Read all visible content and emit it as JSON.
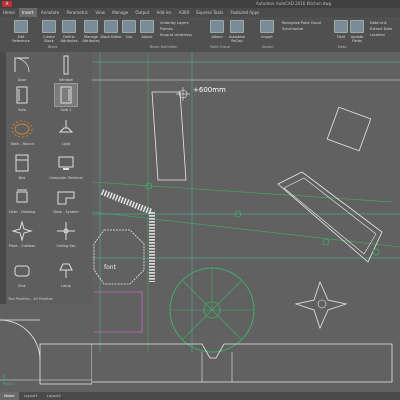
{
  "window": {
    "title": "Autodesk AutoCAD 2016   Kitchen.dwg",
    "app_badge": "A"
  },
  "menu": {
    "items": [
      "Home",
      "Insert",
      "Annotate",
      "Parametric",
      "View",
      "Manage",
      "Output",
      "Add-ins",
      "A360",
      "Express Tools",
      "Featured Apps"
    ],
    "active_index": 1
  },
  "ribbon": {
    "buttons": [
      "Edit Reference",
      "Create Block",
      "Define Attributes",
      "Manage Attributes",
      "Block Editor",
      "Clip",
      "Adjust",
      "Underlay Layers",
      "Frames",
      "Snap to Underlays",
      "Attach",
      "Autodesk ReCap",
      "Import",
      "Field",
      "Update Fields",
      "Data Link",
      "Extract Data"
    ],
    "small_items": [
      "Retain Attribute Display",
      "Synchronize",
      "Recognize Point Cloud",
      "Detach",
      "Location",
      "Set Location"
    ],
    "panels": [
      "Block",
      "Block Definition",
      "Reference",
      "Point Cloud",
      "Import",
      "Data",
      "Linking & Extraction",
      "Location"
    ]
  },
  "palette": {
    "tools": [
      {
        "label": "Door"
      },
      {
        "label": "Window"
      },
      {
        "label": "Sofa"
      },
      {
        "label": "Sofa 2"
      },
      {
        "label": "Table - Round"
      },
      {
        "label": "Light"
      },
      {
        "label": "Bed"
      },
      {
        "label": "Computer Terminal"
      },
      {
        "label": "Chair - Desking"
      },
      {
        "label": "Desk - System"
      },
      {
        "label": "Plant - Outdoor"
      },
      {
        "label": "Ceiling Fan"
      },
      {
        "label": "Sink"
      },
      {
        "label": "Lamp"
      }
    ],
    "footer": "Tool Palettes - All Palettes",
    "selected_index": 3
  },
  "canvas": {
    "dimension_text": "+600mm",
    "label_text": "font"
  },
  "statusbar": {
    "tabs": [
      "Model",
      "Layout1",
      "Layout2"
    ],
    "active_tab_index": 0
  },
  "colors": {
    "line_white": "#e8e8e8",
    "line_green": "#3fb06a",
    "line_cyan": "#4fb7b0",
    "line_magenta": "#c06ac0",
    "line_orange": "#c8803a"
  }
}
